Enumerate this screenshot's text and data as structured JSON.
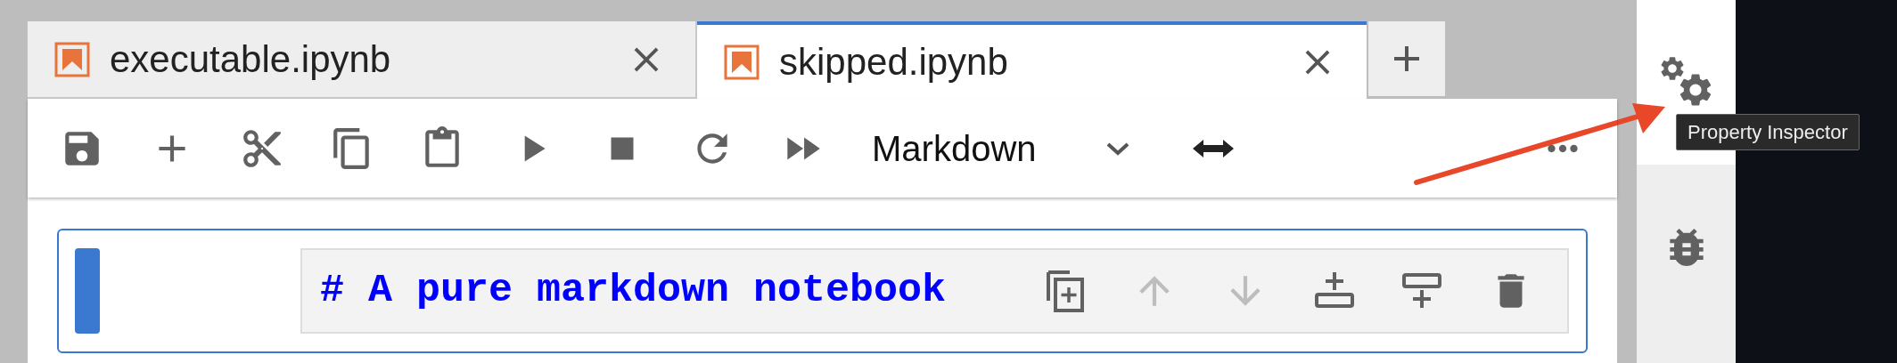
{
  "tabs": [
    {
      "label": "executable.ipynb",
      "selected": false
    },
    {
      "label": "skipped.ipynb",
      "selected": true
    }
  ],
  "toolbar": {
    "cell_type": "Markdown"
  },
  "cells": [
    {
      "source": "# A pure markdown notebook",
      "selected": true,
      "actions": [
        {
          "kind": "duplicate",
          "disabled": false
        },
        {
          "kind": "move-up",
          "disabled": true
        },
        {
          "kind": "move-down",
          "disabled": true
        },
        {
          "kind": "insert-above",
          "disabled": false
        },
        {
          "kind": "insert-below",
          "disabled": false
        },
        {
          "kind": "delete",
          "disabled": false
        }
      ]
    }
  ],
  "sidebar": {
    "items": [
      {
        "kind": "gears",
        "selected": true
      },
      {
        "kind": "bug",
        "selected": false
      }
    ]
  },
  "tooltip": {
    "text": "Property Inspector"
  }
}
